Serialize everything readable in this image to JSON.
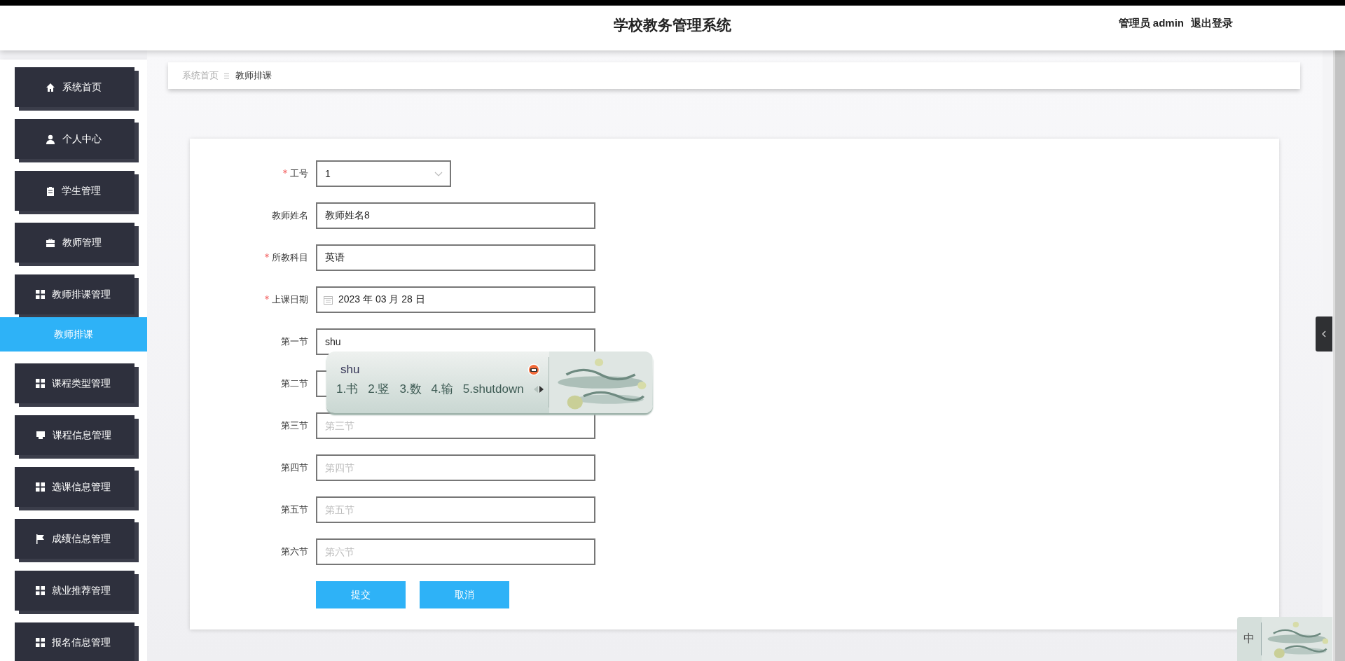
{
  "header": {
    "title": "学校教务管理系统",
    "user": "管理员 admin",
    "logout": "退出登录"
  },
  "sidebar": {
    "items": [
      {
        "label": "系统首页"
      },
      {
        "label": "个人中心"
      },
      {
        "label": "学生管理"
      },
      {
        "label": "教师管理"
      },
      {
        "label": "教师排课管理",
        "children": [
          {
            "label": "教师排课",
            "selected": true
          }
        ]
      },
      {
        "label": "课程类型管理"
      },
      {
        "label": "课程信息管理"
      },
      {
        "label": "选课信息管理"
      },
      {
        "label": "成绩信息管理"
      },
      {
        "label": "就业推荐管理"
      },
      {
        "label": "报名信息管理"
      }
    ]
  },
  "breadcrumb": [
    "系统首页",
    "教师排课"
  ],
  "form": {
    "fields": [
      {
        "label": "工号",
        "kind": "select",
        "required": true,
        "value": "1"
      },
      {
        "label": "教师姓名",
        "kind": "text",
        "required": false,
        "value": "教师姓名8"
      },
      {
        "label": "所教科目",
        "kind": "text",
        "required": true,
        "value": "英语"
      },
      {
        "label": "上课日期",
        "kind": "date",
        "required": true,
        "value": "2023 年 03 月 28 日"
      },
      {
        "label": "第一节",
        "kind": "text",
        "required": false,
        "value": "shu"
      },
      {
        "label": "第二节",
        "kind": "text",
        "required": false
      },
      {
        "label": "第三节",
        "kind": "text",
        "required": false,
        "placeholder": "第三节"
      },
      {
        "label": "第四节",
        "kind": "text",
        "required": false,
        "placeholder": "第四节"
      },
      {
        "label": "第五节",
        "kind": "text",
        "required": false,
        "placeholder": "第五节"
      },
      {
        "label": "第六节",
        "kind": "text",
        "required": false,
        "placeholder": "第六节"
      }
    ],
    "buttons": [
      "提交",
      "取消"
    ]
  },
  "ime": {
    "composition": "shu",
    "candidates": [
      "1.书",
      "2.竖",
      "3.数",
      "4.输",
      "5.shutdown"
    ]
  },
  "ime_status": {
    "mode": "中"
  }
}
